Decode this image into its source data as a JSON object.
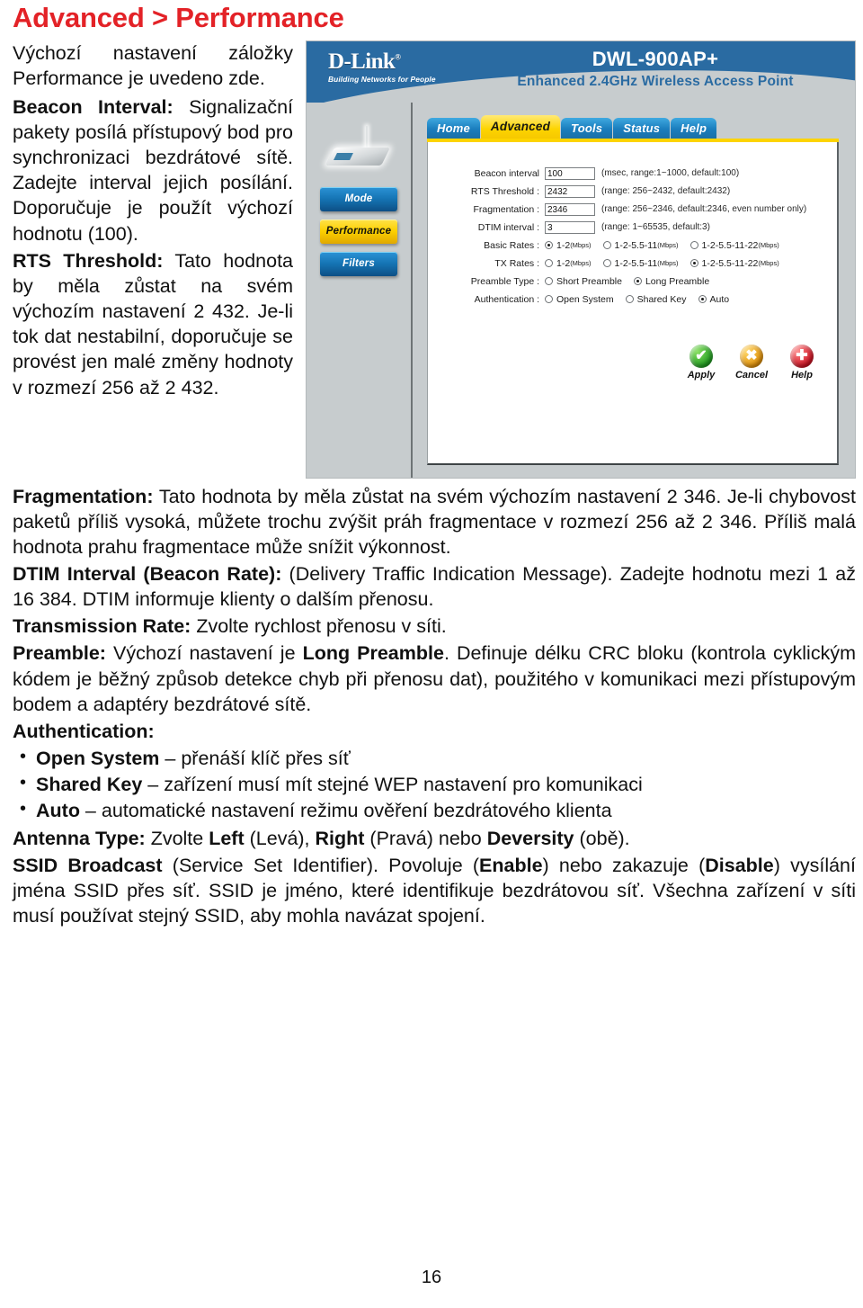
{
  "page": {
    "title": "Advanced > Performance",
    "title_color": "#e32227",
    "folio": "16"
  },
  "screenshot": {
    "brand": "D-Link",
    "brand_registered": "®",
    "brand_tagline": "Building Networks for People",
    "model": "DWL-900AP+",
    "model_subtitle": "Enhanced 2.4GHz Wireless Access Point",
    "device_icon": "access-point-icon",
    "sidebar": [
      {
        "label": "Mode",
        "active": false
      },
      {
        "label": "Performance",
        "active": true
      },
      {
        "label": "Filters",
        "active": false
      }
    ],
    "tabs": [
      {
        "label": "Home",
        "active": false
      },
      {
        "label": "Advanced",
        "active": true
      },
      {
        "label": "Tools",
        "active": false
      },
      {
        "label": "Status",
        "active": false
      },
      {
        "label": "Help",
        "active": false
      }
    ],
    "fields": [
      {
        "label": "Beacon interval",
        "value": "100",
        "hint": "(msec, range:1~1000, default:100)"
      },
      {
        "label": "RTS Threshold :",
        "value": "2432",
        "hint": "(range: 256~2432, default:2432)"
      },
      {
        "label": "Fragmentation :",
        "value": "2346",
        "hint": "(range: 256~2346, default:2346, even number only)"
      },
      {
        "label": "DTIM interval :",
        "value": "3",
        "hint": "(range: 1~65535, default:3)"
      }
    ],
    "radio_rows": [
      {
        "label": "Basic Rates :",
        "options": [
          {
            "text": "1-2",
            "unit": "(Mbps)",
            "selected": true
          },
          {
            "text": "1-2-5.5-11",
            "unit": "(Mbps)",
            "selected": false
          },
          {
            "text": "1-2-5.5-11-22",
            "unit": "(Mbps)",
            "selected": false
          }
        ]
      },
      {
        "label": "TX Rates :",
        "options": [
          {
            "text": "1-2",
            "unit": "(Mbps)",
            "selected": false
          },
          {
            "text": "1-2-5.5-11",
            "unit": "(Mbps)",
            "selected": false
          },
          {
            "text": "1-2-5.5-11-22",
            "unit": "(Mbps)",
            "selected": true
          }
        ]
      },
      {
        "label": "Preamble Type :",
        "options": [
          {
            "text": "Short Preamble",
            "unit": "",
            "selected": false
          },
          {
            "text": "Long Preamble",
            "unit": "",
            "selected": true
          }
        ]
      },
      {
        "label": "Authentication :",
        "options": [
          {
            "text": "Open System",
            "unit": "",
            "selected": false
          },
          {
            "text": "Shared Key",
            "unit": "",
            "selected": false
          },
          {
            "text": "Auto",
            "unit": "",
            "selected": true
          }
        ]
      }
    ],
    "actions": [
      {
        "label": "Apply",
        "icon": "check-circle-icon",
        "glyph": "✔",
        "color": "#1f9c20"
      },
      {
        "label": "Cancel",
        "icon": "x-circle-icon",
        "glyph": "✖",
        "color": "#e08f08"
      },
      {
        "label": "Help",
        "icon": "plus-circle-icon",
        "glyph": "✚",
        "color": "#cc1020"
      }
    ]
  },
  "body": {
    "intro": "Výchozí nastavení záložky Performance je uvedeno zde.",
    "p_beacon_label": "Beacon Interval:",
    "p_beacon_text": " Signalizační pakety posílá přístupový bod pro synchronizaci bezdrátové sítě. Zadejte interval jejich posílání. Doporučuje je použít výchozí hodnotu (100).",
    "p_rts_label": "RTS Threshold:",
    "p_rts_text": " Tato hodnota by měla zůstat na svém výchozím nastavení 2 432. Je-li tok dat nestabilní, doporučuje se provést jen malé změny hodnoty v rozmezí 256 až 2 432.",
    "p_frag_label": "Fragmentation:",
    "p_frag_text": " Tato hodnota by měla zůstat na svém výchozím nastavení 2 346. Je-li chybovost paketů příliš vysoká, můžete trochu zvýšit práh fragmentace v rozmezí 256 až 2 346. Příliš malá hodnota prahu fragmentace může snížit výkonnost.",
    "p_dtim_label": "DTIM Interval (Beacon Rate):",
    "p_dtim_text": " (Delivery Traffic Indication Message). Zadejte hodnotu mezi 1 až 16 384. DTIM informuje klienty o dalším přenosu.",
    "p_tx_label": "Transmission Rate:",
    "p_tx_text": " Zvolte rychlost přenosu v síti.",
    "p_preamble_label": "Preamble:",
    "p_preamble_t1": " Výchozí nastavení je ",
    "p_preamble_b1": "Long Preamble",
    "p_preamble_t2": ". Definuje délku CRC bloku (kontrola cyklickým kódem je běžný způsob detekce chyb při přenosu dat), použitého v komunikaci mezi přístupovým bodem a adaptéry bezdrátové sítě.",
    "p_auth_label": "Authentication:",
    "auth_bullets": [
      {
        "term": "Open System",
        "desc": " – přenáší klíč přes síť"
      },
      {
        "term": "Shared Key",
        "desc": " – zařízení musí mít stejné WEP nastavení pro komunikaci"
      },
      {
        "term": "Auto",
        "desc": " – automatické nastavení režimu ověření bezdrátového klienta"
      }
    ],
    "p_antenna_label": "Antenna Type:",
    "p_antenna_t1": " Zvolte ",
    "p_antenna_b1": "Left",
    "p_antenna_t2": " (Levá), ",
    "p_antenna_b2": "Right",
    "p_antenna_t3": " (Pravá) nebo ",
    "p_antenna_b3": "Deversity",
    "p_antenna_t4": " (obě).",
    "p_ssid_label": "SSID Broadcast",
    "p_ssid_t1": " (Service Set Identifier). Povoluje (",
    "p_ssid_b1": "Enable",
    "p_ssid_t2": ") nebo zakazuje (",
    "p_ssid_b2": "Disable",
    "p_ssid_t3": ") vysílání jména SSID přes síť. SSID je jméno, které identifikuje bezdrátovou síť. Všechna zařízení v síti musí používat stejný SSID, aby mohla navázat spojení."
  }
}
